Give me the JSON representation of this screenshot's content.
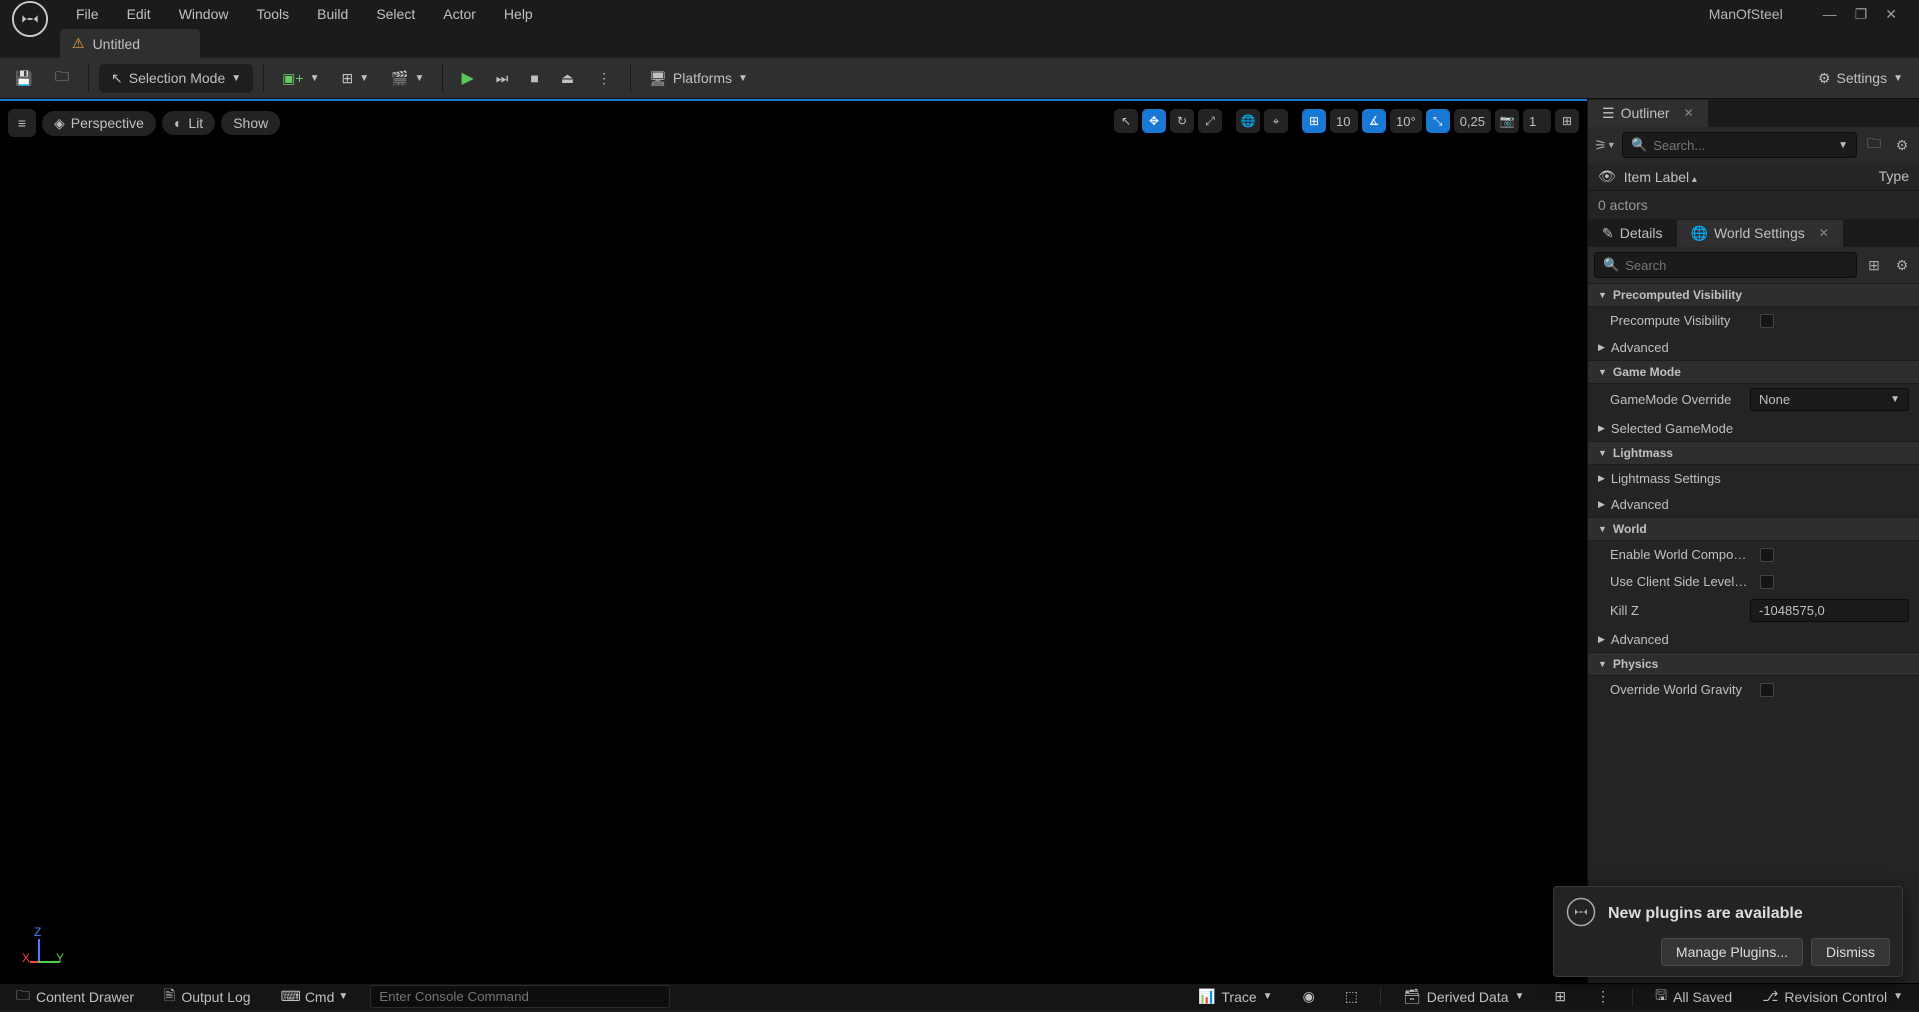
{
  "menu": {
    "file": "File",
    "edit": "Edit",
    "window": "Window",
    "tools": "Tools",
    "build": "Build",
    "select": "Select",
    "actor": "Actor",
    "help": "Help"
  },
  "app_title": "ManOfSteel",
  "tabs": {
    "level_name": "Untitled"
  },
  "toolbar": {
    "selection_mode": "Selection Mode",
    "platforms": "Platforms",
    "settings": "Settings"
  },
  "viewport": {
    "menu": "≡",
    "perspective": "Perspective",
    "lit": "Lit",
    "show": "Show",
    "grid_snap": "10",
    "angle_snap": "10°",
    "scale_snap": "0,25",
    "camera_speed": "1"
  },
  "outliner": {
    "tab": "Outliner",
    "search_placeholder": "Search...",
    "col_item": "Item Label",
    "col_type": "Type",
    "count": "0 actors"
  },
  "details_tab": "Details",
  "world_settings_tab": "World Settings",
  "ws_search_placeholder": "Search",
  "ws": {
    "sec_pcv": "Precomputed Visibility",
    "pcv_prop": "Precompute Visibility",
    "advanced": "Advanced",
    "sec_gamemode": "Game Mode",
    "gm_override": "GameMode Override",
    "gm_override_val": "None",
    "gm_selected": "Selected GameMode",
    "sec_lightmass": "Lightmass",
    "lm_settings": "Lightmass Settings",
    "sec_world": "World",
    "w_enable_comp": "Enable World Composition",
    "w_client_stream": "Use Client Side Level Strea...",
    "w_killz": "Kill Z",
    "w_killz_val": "-1048575,0",
    "sec_physics": "Physics",
    "phys_override": "Override World Gravity"
  },
  "notif": {
    "title": "New plugins are available",
    "manage": "Manage Plugins...",
    "dismiss": "Dismiss"
  },
  "status": {
    "content_drawer": "Content Drawer",
    "output_log": "Output Log",
    "cmd": "Cmd",
    "cmd_placeholder": "Enter Console Command",
    "trace": "Trace",
    "derived": "Derived Data",
    "saved": "All Saved",
    "revision": "Revision Control"
  }
}
